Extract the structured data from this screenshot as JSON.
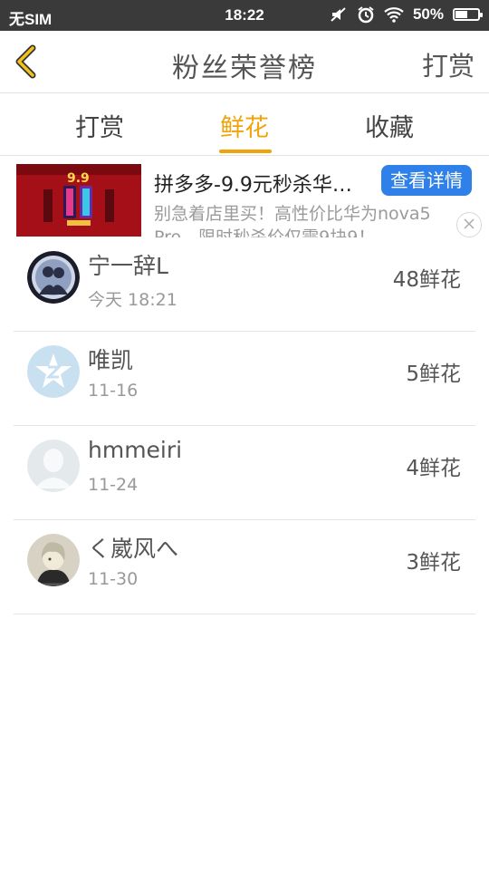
{
  "status_bar": {
    "carrier": "无SIM",
    "time": "18:22",
    "battery": "50%",
    "battery_level": 0.5
  },
  "header": {
    "title": "粉丝荣誉榜",
    "right_action": "打赏"
  },
  "tabs": [
    {
      "label": "打赏"
    },
    {
      "label": "鲜花",
      "active": true
    },
    {
      "label": "收藏"
    }
  ],
  "ad": {
    "title": "拼多多-9.9元秒杀华…",
    "button": "查看详情",
    "description": "别急着店里买！高性价比华为nova5 Pro，限时秒杀价仅需9块9！",
    "image_text": "9.9"
  },
  "list": [
    {
      "name": "宁一辞L",
      "date": "今天 18:21",
      "count": "48鲜花"
    },
    {
      "name": "唯凯",
      "date": "11-16",
      "count": "5鲜花"
    },
    {
      "name": "hmmeiri",
      "date": "11-24",
      "count": "4鲜花"
    },
    {
      "name": "く崴风へ",
      "date": "11-30",
      "count": "3鲜花"
    }
  ],
  "colors": {
    "accent": "#f0a30a",
    "ad_button": "#2f80e8",
    "status_bar": "#3a3a3a"
  }
}
